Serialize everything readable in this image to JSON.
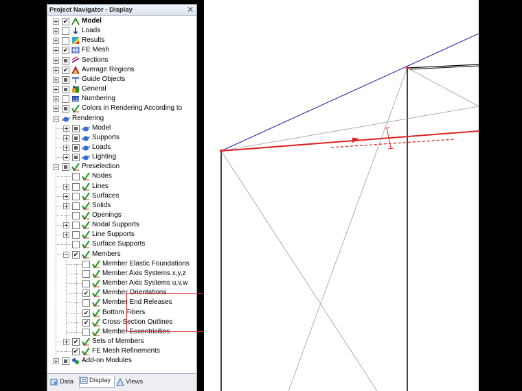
{
  "panel": {
    "title": "Project Navigator - Display",
    "close_label": "✕"
  },
  "tree": [
    {
      "id": "model",
      "label": "Model",
      "depth": 0,
      "expander": "plus",
      "check": "checked",
      "icon": "model-icon",
      "bold": true
    },
    {
      "id": "loads",
      "label": "Loads",
      "depth": 0,
      "expander": "plus",
      "check": "unchecked",
      "icon": "loads-icon"
    },
    {
      "id": "results",
      "label": "Results",
      "depth": 0,
      "expander": "plus",
      "check": "unchecked",
      "icon": "results-icon"
    },
    {
      "id": "fe-mesh",
      "label": "FE Mesh",
      "depth": 0,
      "expander": "plus",
      "check": "checked",
      "icon": "fe-mesh-icon"
    },
    {
      "id": "sections",
      "label": "Sections",
      "depth": 0,
      "expander": "plus",
      "check": "partial",
      "icon": "sections-icon"
    },
    {
      "id": "average-regions",
      "label": "Average Regions",
      "depth": 0,
      "expander": "plus",
      "check": "checked",
      "icon": "average-regions-icon"
    },
    {
      "id": "guide-objects",
      "label": "Guide Objects",
      "depth": 0,
      "expander": "plus",
      "check": "partial",
      "icon": "guide-objects-icon"
    },
    {
      "id": "general",
      "label": "General",
      "depth": 0,
      "expander": "plus",
      "check": "partial",
      "icon": "general-icon"
    },
    {
      "id": "numbering",
      "label": "Numbering",
      "depth": 0,
      "expander": "plus",
      "check": "unchecked",
      "icon": "numbering-icon"
    },
    {
      "id": "colors-rendering",
      "label": "Colors in Rendering According to",
      "depth": 0,
      "expander": "plus",
      "check": "partial",
      "icon": "green-check-icon"
    },
    {
      "id": "rendering",
      "label": "Rendering",
      "depth": 0,
      "expander": "minus",
      "check": "none",
      "icon": "teapot-icon"
    },
    {
      "id": "rendering-model",
      "label": "Model",
      "depth": 1,
      "expander": "plus",
      "check": "partial",
      "icon": "teapot-icon"
    },
    {
      "id": "rendering-supports",
      "label": "Supports",
      "depth": 1,
      "expander": "plus",
      "check": "partial",
      "icon": "teapot-icon"
    },
    {
      "id": "rendering-loads",
      "label": "Loads",
      "depth": 1,
      "expander": "plus",
      "check": "partial",
      "icon": "teapot-icon"
    },
    {
      "id": "rendering-lighting",
      "label": "Lighting",
      "depth": 1,
      "expander": "plus",
      "check": "partial",
      "icon": "teapot-icon"
    },
    {
      "id": "preselection",
      "label": "Preselection",
      "depth": 0,
      "expander": "minus",
      "check": "partial",
      "icon": "green-check-icon"
    },
    {
      "id": "nodes",
      "label": "Nodes",
      "depth": 1,
      "expander": "none",
      "check": "unchecked",
      "icon": "green-check-icon"
    },
    {
      "id": "lines",
      "label": "Lines",
      "depth": 1,
      "expander": "plus",
      "check": "unchecked",
      "icon": "green-check-icon"
    },
    {
      "id": "surfaces",
      "label": "Surfaces",
      "depth": 1,
      "expander": "plus",
      "check": "unchecked",
      "icon": "green-check-icon"
    },
    {
      "id": "solids",
      "label": "Solids",
      "depth": 1,
      "expander": "plus",
      "check": "unchecked",
      "icon": "green-check-icon"
    },
    {
      "id": "openings",
      "label": "Openings",
      "depth": 1,
      "expander": "none",
      "check": "unchecked",
      "icon": "green-check-icon"
    },
    {
      "id": "nodal-supports",
      "label": "Nodal Supports",
      "depth": 1,
      "expander": "plus",
      "check": "unchecked",
      "icon": "green-check-icon"
    },
    {
      "id": "line-supports",
      "label": "Line Supports",
      "depth": 1,
      "expander": "plus",
      "check": "unchecked",
      "icon": "green-check-icon"
    },
    {
      "id": "surface-supports",
      "label": "Surface Supports",
      "depth": 1,
      "expander": "none",
      "check": "unchecked",
      "icon": "green-check-icon"
    },
    {
      "id": "members",
      "label": "Members",
      "depth": 1,
      "expander": "minus",
      "check": "checked",
      "icon": "green-check-icon"
    },
    {
      "id": "member-elastic-foundations",
      "label": "Member Elastic Foundations",
      "depth": 2,
      "expander": "none",
      "check": "unchecked",
      "icon": "green-check-icon"
    },
    {
      "id": "member-axis-xyz",
      "label": "Member Axis Systems x,y,z",
      "depth": 2,
      "expander": "none",
      "check": "unchecked",
      "icon": "green-check-icon"
    },
    {
      "id": "member-axis-uvw",
      "label": "Member Axis Systems u,v,w",
      "depth": 2,
      "expander": "none",
      "check": "unchecked",
      "icon": "green-check-icon"
    },
    {
      "id": "member-orientations",
      "label": "Member Orientations",
      "depth": 2,
      "expander": "none",
      "check": "checked",
      "icon": "green-check-icon"
    },
    {
      "id": "member-end-releases",
      "label": "Member End Releases",
      "depth": 2,
      "expander": "none",
      "check": "unchecked",
      "icon": "green-check-icon"
    },
    {
      "id": "bottom-fibers",
      "label": "Bottom Fibers",
      "depth": 2,
      "expander": "none",
      "check": "checked",
      "icon": "green-check-icon"
    },
    {
      "id": "cross-section-outlines",
      "label": "Cross-Section Outlines",
      "depth": 2,
      "expander": "none",
      "check": "checked",
      "icon": "green-check-icon"
    },
    {
      "id": "member-eccentricities",
      "label": "Member Eccentricities",
      "depth": 2,
      "expander": "none",
      "check": "unchecked",
      "icon": "green-check-icon"
    },
    {
      "id": "sets-of-members",
      "label": "Sets of Members",
      "depth": 1,
      "expander": "plus",
      "check": "checked",
      "icon": "green-check-icon"
    },
    {
      "id": "fe-mesh-refinements",
      "label": "FE Mesh Refinements",
      "depth": 1,
      "expander": "none",
      "check": "checked",
      "icon": "green-check-icon"
    },
    {
      "id": "add-on-modules",
      "label": "Add-on Modules",
      "depth": 0,
      "expander": "plus",
      "check": "partial",
      "icon": "add-on-modules-icon"
    }
  ],
  "tabs": [
    {
      "label": "Data",
      "icon": "data-icon",
      "active": false
    },
    {
      "label": "Display",
      "icon": "display-icon",
      "active": true
    },
    {
      "label": "Views",
      "icon": "views-icon",
      "active": false
    }
  ],
  "colors": {
    "model_edge": "#1a1aa0",
    "member_highlight": "#e02020",
    "outline": "#000000",
    "helper_line": "#9a9a9a"
  }
}
